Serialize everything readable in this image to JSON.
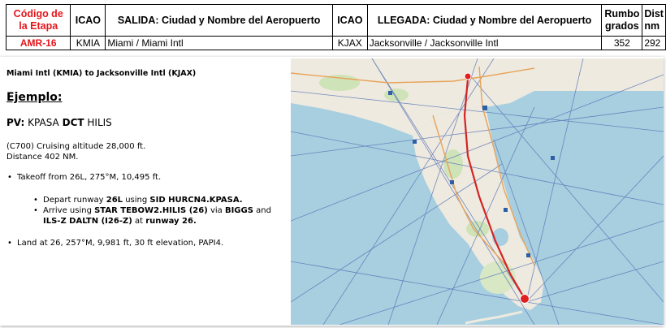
{
  "table": {
    "headers": {
      "codigo": "Código de la Etapa",
      "icao_dep": "ICAO",
      "salida": "SALIDA: Ciudad y Nombre del Aeropuerto",
      "icao_arr": "ICAO",
      "llegada": "LLEGADA: Ciudad y Nombre del Aeropuerto",
      "rumbo": "Rumbo grados",
      "dist": "Dist nm"
    },
    "row": {
      "codigo": "AMR-16",
      "icao_dep": "KMIA",
      "salida": "Miami / Miami Intl",
      "icao_arr": "KJAX",
      "llegada": "Jacksonville / Jacksonville Intl",
      "rumbo": "352",
      "dist": "292"
    }
  },
  "doc": {
    "route_title": "Miami Intl (KMIA) to Jacksonville Intl (KJAX)",
    "example_heading": "Ejemplo:",
    "pv_label": "PV:",
    "pv_route_a": "KPASA",
    "pv_route_b": "DCT",
    "pv_route_c": "HILIS",
    "cruise_line": "(C700) Cruising altitude 28,000 ft.",
    "distance_line": "Distance 402 NM.",
    "bullet_takeoff": "Takeoff from 26L, 275°M, 10,495 ft.",
    "depart": {
      "t1": "Depart runway ",
      "runway": "26L",
      "t2": " using ",
      "sid": "SID HURCN4.KPASA."
    },
    "arrive": {
      "t1": "Arrive using ",
      "star": "STAR TEBOW2.HILIS (26)",
      "t2": " via ",
      "fix": "BIGGS",
      "t3": " and ",
      "ils": "ILS-Z DALTN (I26-Z)",
      "t4": " at ",
      "runway": "runway 26."
    },
    "bullet_land": "Land at 26, 257°M, 9,981 ft, 30 ft elevation, PAPI4."
  },
  "colors": {
    "header_red": "#e3161b",
    "map_water": "#a7cfe0",
    "map_land": "#eeeadf",
    "route_line": "#d32424",
    "airway_lines": "#5d78b8"
  },
  "map": {
    "icons": [
      "airport-icon",
      "navaid-icon"
    ]
  }
}
